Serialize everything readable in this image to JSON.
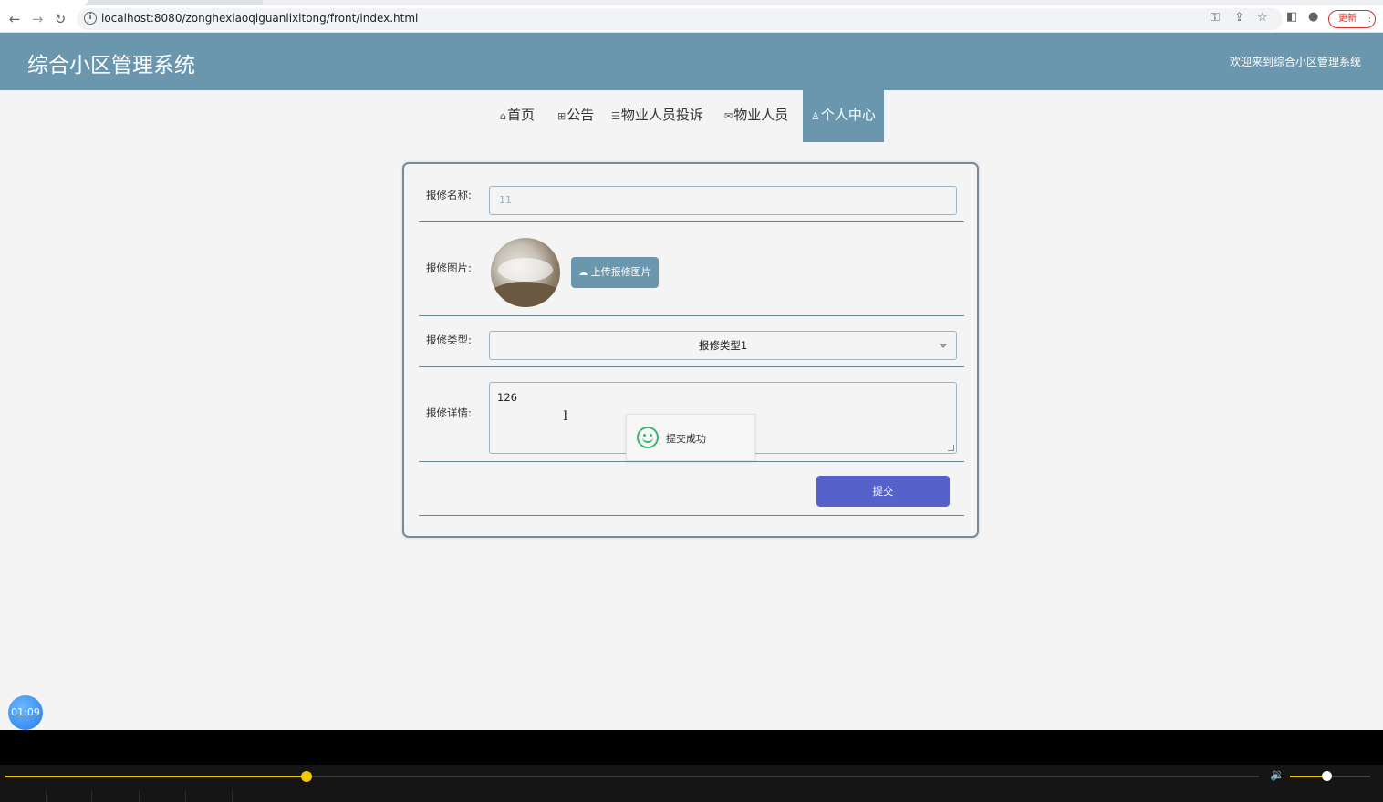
{
  "browser": {
    "url": "localhost:8080/zonghexiaoqiguanlixitong/front/index.html",
    "update_label": "更新",
    "icons": [
      "back-icon",
      "forward-icon",
      "reload-icon",
      "key-icon",
      "share-icon",
      "star-icon",
      "sidebar-icon",
      "profile-icon",
      "menu-dots-icon"
    ]
  },
  "header": {
    "title": "综合小区管理系统",
    "welcome": "欢迎来到综合小区管理系统"
  },
  "menu": {
    "items": [
      {
        "label": "首页",
        "icon": "home-icon",
        "glyph": "⌂"
      },
      {
        "label": "公告",
        "icon": "notice-icon",
        "glyph": "⊞"
      },
      {
        "label": "物业人员投诉",
        "icon": "complaint-icon",
        "glyph": "☰"
      },
      {
        "label": "物业人员",
        "icon": "mail-icon",
        "glyph": "✉"
      },
      {
        "label": "个人中心",
        "icon": "user-icon",
        "glyph": "♙",
        "active": true
      }
    ]
  },
  "form": {
    "name_label": "报修名称:",
    "name_value": "11",
    "image_label": "报修图片:",
    "upload_label": "上传报修图片",
    "upload_icon": "cloud-upload-icon",
    "type_label": "报修类型:",
    "type_value": "报修类型1",
    "detail_label": "报修详情:",
    "detail_value": "126",
    "submit_label": "提交"
  },
  "toast": {
    "message": "提交成功",
    "icon": "smile-icon"
  },
  "overlay": {
    "timer": "01:09"
  },
  "player": {
    "progress": 0.24,
    "volume": 0.45,
    "accent_color": "#f2c800"
  },
  "colors": {
    "header_bg": "#6a97ae",
    "submit_bg": "#5661c9",
    "toast_icon": "#3cb371"
  }
}
